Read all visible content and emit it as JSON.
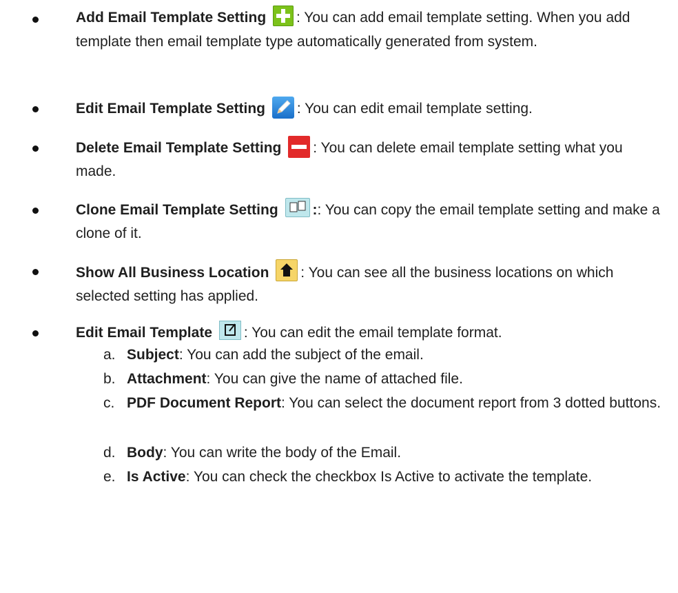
{
  "items": [
    {
      "title": "Add Email Template Setting",
      "text": ": You can add email template setting. When you add template then email template type automatically generated from system.",
      "icon": "add-icon"
    },
    {
      "title": "Edit Email Template Setting",
      "text": ": You can edit email template setting.",
      "icon": "edit-pencil-icon"
    },
    {
      "title": "Delete Email Template Setting",
      "text": ": You can delete email template setting what you made.",
      "icon": "delete-icon"
    },
    {
      "title": "Clone Email Template Setting",
      "text": ": You can copy the email template setting and make a clone of it.",
      "icon": "clone-icon"
    },
    {
      "title": "Show All Business Location",
      "text": ": You can see all the business locations on which selected setting has applied.",
      "icon": "home-icon"
    },
    {
      "title": "Edit Email Template",
      "text": ": You can edit the email template format.",
      "icon": "edit-template-icon"
    }
  ],
  "subitems": [
    {
      "letter": "a.",
      "title": "Subject",
      "text": ": You can add the subject of the email."
    },
    {
      "letter": "b.",
      "title": "Attachment",
      "text": ": You can give the name of attached file."
    },
    {
      "letter": "c.",
      "title": "PDF Document Report",
      "text": ": You can select the document report from 3 dotted buttons."
    },
    {
      "letter": "d.",
      "title": "Body",
      "text": ": You can write the body of the Email."
    },
    {
      "letter": "e.",
      "title": "Is Active",
      "text": ": You can check the checkbox Is Active to activate the template."
    }
  ]
}
